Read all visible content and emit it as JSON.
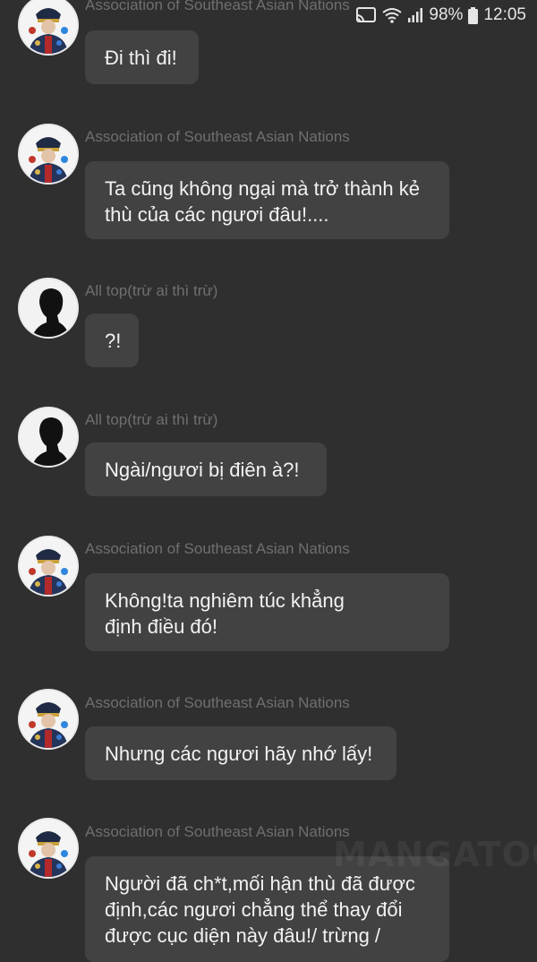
{
  "status_bar": {
    "battery_percent": "98%",
    "time": "12:05",
    "icons": [
      "cast-icon",
      "wifi-icon",
      "signal-icon",
      "battery-icon"
    ]
  },
  "messages": [
    {
      "avatar": "asean-avatar",
      "sender": "Association of Southeast Asian Nations",
      "text": "Đi thì đi!"
    },
    {
      "avatar": "asean-avatar",
      "sender": "Association of Southeast Asian Nations",
      "text": "Ta cũng không ngại mà trở thành kẻ thù của các ngươi đâu!...."
    },
    {
      "avatar": "silhouette-avatar",
      "sender": "All top(trừ ai thì trừ)",
      "text": "?!"
    },
    {
      "avatar": "silhouette-avatar",
      "sender": "All top(trừ ai thì trừ)",
      "text": "Ngài/ngươi bị điên à?!"
    },
    {
      "avatar": "asean-avatar",
      "sender": "Association of Southeast Asian Nations",
      "text": "Không!ta nghiêm túc khẳng định điều đó!"
    },
    {
      "avatar": "asean-avatar",
      "sender": "Association of Southeast Asian Nations",
      "text": "Nhưng các ngươi hãy nhớ lấy!"
    },
    {
      "avatar": "asean-avatar",
      "sender": "Association of Southeast Asian Nations",
      "text": "Người đã ch*t,mối hận thù đã được định,các ngươi chẳng thể thay đổi được cục diện này đâu!/ trừng /"
    }
  ],
  "watermark": "MANGATOON",
  "colors": {
    "background": "#2f2f2f",
    "bubble": "#424242",
    "sender_text": "#6f6f6f",
    "message_text": "#f2f2f2"
  }
}
